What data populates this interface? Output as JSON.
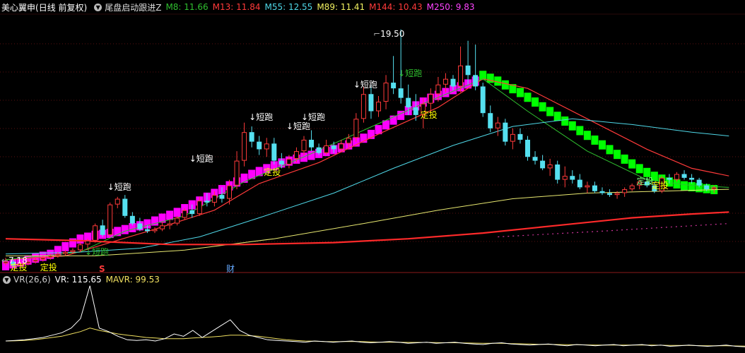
{
  "stock_title": "美心翼申",
  "period_label": "(日线 前复权)",
  "dropdown_icon": "chevron-down-icon",
  "indicator_name": "尾盘启动跟进Z",
  "ma_values": [
    {
      "label": "M8: 11.66",
      "color": "#2fbf2f"
    },
    {
      "label": "M13: 11.84",
      "color": "#ff3a3a"
    },
    {
      "label": "M55: 12.55",
      "color": "#4fd8e8"
    },
    {
      "label": "M89: 11.41",
      "color": "#f0f060"
    },
    {
      "label": "M144: 10.43",
      "color": "#ff3a3a"
    },
    {
      "label": "M250: 9.83",
      "color": "#ff44ff"
    }
  ],
  "high_label": "19.50",
  "low_label": "7.18",
  "markers": {
    "short_run": "↓短跑",
    "short_run_up": "↓短跑",
    "dca": "定投",
    "finance": "财",
    "s_mark": "S"
  },
  "vr_panel": {
    "name": "VR(26,6)",
    "vr": "VR: 115.65",
    "mavr": "MAVR: 99.53",
    "vr_color": "#ffffff",
    "mavr_color": "#f0e060"
  },
  "colors": {
    "up": "#ff3a3a",
    "down": "#55e0f0",
    "magenta": "#ff00ff",
    "green": "#00ff00",
    "label": "#ffffff",
    "dca": "#ffff00",
    "green_label": "#2fbf2f"
  },
  "chart_data": {
    "type": "candlestick",
    "price_range": [
      6.8,
      20.3
    ],
    "candles": [
      [
        7.2,
        7.5,
        7.1,
        7.3
      ],
      [
        7.3,
        7.4,
        7.0,
        7.1
      ],
      [
        7.1,
        7.3,
        7.0,
        7.2
      ],
      [
        7.2,
        7.4,
        7.1,
        7.3
      ],
      [
        7.3,
        7.5,
        7.2,
        7.4
      ],
      [
        7.4,
        7.6,
        7.3,
        7.5
      ],
      [
        7.5,
        7.7,
        7.4,
        7.6
      ],
      [
        7.6,
        7.8,
        7.5,
        7.7
      ],
      [
        7.7,
        7.9,
        7.6,
        7.8
      ],
      [
        7.8,
        8.0,
        7.7,
        7.9
      ],
      [
        7.9,
        8.3,
        7.8,
        8.2
      ],
      [
        8.2,
        8.5,
        8.0,
        8.4
      ],
      [
        8.4,
        9.3,
        8.3,
        9.2
      ],
      [
        9.2,
        9.5,
        8.6,
        8.7
      ],
      [
        8.7,
        10.4,
        8.6,
        10.3
      ],
      [
        10.3,
        10.7,
        10.1,
        10.6
      ],
      [
        10.6,
        10.8,
        9.6,
        9.7
      ],
      [
        9.7,
        9.9,
        9.2,
        9.3
      ],
      [
        9.3,
        9.6,
        8.9,
        9.0
      ],
      [
        9.0,
        9.2,
        8.8,
        8.9
      ],
      [
        8.9,
        9.1,
        8.8,
        9.0
      ],
      [
        9.0,
        9.4,
        8.9,
        9.2
      ],
      [
        9.2,
        9.5,
        9.0,
        9.3
      ],
      [
        9.3,
        9.7,
        9.2,
        9.6
      ],
      [
        9.6,
        10.1,
        9.5,
        10.0
      ],
      [
        10.0,
        10.3,
        9.6,
        9.8
      ],
      [
        9.8,
        10.7,
        9.7,
        10.5
      ],
      [
        10.5,
        10.9,
        10.2,
        10.4
      ],
      [
        10.4,
        11.0,
        10.2,
        10.8
      ],
      [
        10.8,
        11.2,
        10.4,
        10.6
      ],
      [
        10.6,
        11.6,
        10.3,
        11.3
      ],
      [
        11.3,
        13.1,
        11.1,
        12.6
      ],
      [
        12.6,
        14.6,
        12.3,
        14.1
      ],
      [
        14.1,
        14.4,
        13.3,
        13.6
      ],
      [
        13.6,
        13.9,
        12.9,
        13.2
      ],
      [
        13.2,
        13.8,
        12.8,
        13.5
      ],
      [
        13.5,
        13.8,
        12.4,
        12.6
      ],
      [
        12.6,
        13.0,
        12.2,
        12.4
      ],
      [
        12.4,
        12.9,
        12.2,
        12.7
      ],
      [
        12.7,
        13.3,
        12.5,
        13.1
      ],
      [
        13.1,
        13.9,
        12.9,
        13.7
      ],
      [
        13.7,
        14.2,
        13.1,
        13.3
      ],
      [
        13.3,
        13.5,
        12.9,
        13.0
      ],
      [
        13.0,
        13.7,
        12.9,
        13.4
      ],
      [
        13.4,
        13.6,
        13.0,
        13.2
      ],
      [
        13.2,
        13.7,
        13.1,
        13.5
      ],
      [
        13.5,
        14.0,
        13.3,
        13.8
      ],
      [
        13.8,
        15.1,
        13.6,
        14.8
      ],
      [
        14.8,
        16.5,
        14.6,
        16.1
      ],
      [
        16.1,
        16.6,
        14.8,
        15.2
      ],
      [
        15.2,
        16.0,
        14.9,
        15.7
      ],
      [
        15.7,
        17.1,
        15.3,
        16.7
      ],
      [
        16.7,
        18.1,
        16.1,
        16.4
      ],
      [
        16.4,
        19.5,
        15.6,
        15.9
      ],
      [
        15.9,
        16.6,
        15.0,
        15.4
      ],
      [
        15.4,
        16.1,
        14.7,
        15.0
      ],
      [
        15.0,
        15.9,
        14.3,
        15.6
      ],
      [
        15.6,
        16.4,
        15.1,
        16.1
      ],
      [
        16.1,
        17.0,
        15.7,
        16.6
      ],
      [
        16.6,
        17.2,
        16.2,
        16.9
      ],
      [
        16.9,
        17.1,
        16.3,
        16.5
      ],
      [
        16.5,
        18.6,
        16.2,
        17.6
      ],
      [
        17.6,
        18.9,
        16.6,
        17.1
      ],
      [
        17.1,
        18.7,
        16.3,
        16.5
      ],
      [
        16.5,
        16.7,
        14.9,
        15.1
      ],
      [
        15.1,
        15.5,
        14.1,
        14.3
      ],
      [
        14.3,
        14.9,
        13.9,
        14.6
      ],
      [
        14.6,
        14.8,
        13.4,
        13.6
      ],
      [
        13.6,
        14.3,
        13.2,
        14.0
      ],
      [
        14.0,
        14.3,
        13.5,
        13.7
      ],
      [
        13.7,
        13.9,
        12.6,
        12.8
      ],
      [
        12.8,
        13.1,
        12.4,
        12.6
      ],
      [
        12.6,
        12.9,
        12.1,
        12.2
      ],
      [
        12.2,
        12.7,
        11.8,
        12.4
      ],
      [
        12.4,
        12.6,
        11.4,
        11.6
      ],
      [
        11.6,
        12.3,
        11.2,
        11.8
      ],
      [
        11.8,
        12.1,
        11.4,
        11.6
      ],
      [
        11.6,
        11.9,
        11.1,
        11.2
      ],
      [
        11.2,
        11.5,
        10.9,
        11.3
      ],
      [
        11.3,
        11.5,
        10.9,
        11.0
      ],
      [
        11.0,
        11.2,
        10.8,
        10.9
      ],
      [
        10.9,
        11.1,
        10.7,
        10.8
      ],
      [
        10.8,
        11.0,
        10.6,
        10.9
      ],
      [
        10.9,
        11.2,
        10.7,
        11.1
      ],
      [
        11.1,
        11.4,
        11.0,
        11.3
      ],
      [
        11.3,
        11.6,
        11.1,
        11.5
      ],
      [
        11.5,
        11.7,
        11.2,
        11.3
      ],
      [
        11.3,
        11.5,
        10.9,
        11.0
      ],
      [
        11.0,
        11.8,
        10.9,
        11.7
      ],
      [
        11.7,
        11.9,
        11.4,
        11.6
      ],
      [
        11.6,
        12.0,
        11.5,
        11.9
      ],
      [
        11.9,
        12.1,
        11.6,
        11.7
      ],
      [
        11.7,
        11.9,
        11.4,
        11.6
      ],
      [
        11.6,
        11.7,
        11.2,
        11.3
      ],
      [
        11.3,
        11.4,
        11.0,
        11.1
      ],
      [
        11.1,
        11.3,
        10.9,
        11.2
      ]
    ],
    "band": {
      "magenta": [
        7.1,
        7.2,
        7.3,
        7.4,
        7.5,
        7.6,
        7.7,
        7.9,
        8.1,
        8.3,
        8.5,
        8.6,
        8.7,
        8.75,
        8.8,
        8.9,
        9.0,
        9.1,
        9.2,
        9.3,
        9.45,
        9.6,
        9.75,
        9.9,
        10.1,
        10.3,
        10.5,
        10.7,
        10.9,
        11.1,
        11.3,
        11.5,
        11.7,
        11.9,
        12.05,
        12.2,
        12.35,
        12.5,
        12.6,
        12.7,
        12.8,
        12.9,
        13.0,
        13.1,
        13.2,
        13.3,
        13.45,
        13.6,
        13.8,
        14.0,
        14.25,
        14.5,
        14.75,
        15.0,
        15.25,
        15.5,
        15.7,
        15.9,
        16.05,
        16.2,
        16.35,
        16.5,
        16.65,
        16.8
      ],
      "green_start": 64,
      "green": [
        17.1,
        16.95,
        16.8,
        16.6,
        16.4,
        16.2,
        15.95,
        15.7,
        15.45,
        15.2,
        14.95,
        14.7,
        14.45,
        14.2,
        13.95,
        13.7,
        13.45,
        13.2,
        12.95,
        12.7,
        12.45,
        12.2,
        12.0,
        11.8,
        11.65,
        11.5,
        11.4,
        11.3,
        11.25,
        11.2,
        11.15,
        11.1
      ]
    },
    "lines": [
      {
        "name": "M13",
        "color": "#ff3a3a",
        "width": 1.2,
        "points": [
          [
            0,
            7.4
          ],
          [
            8,
            7.6
          ],
          [
            14,
            8.3
          ],
          [
            20,
            9.0
          ],
          [
            28,
            10.0
          ],
          [
            34,
            11.4
          ],
          [
            42,
            12.5
          ],
          [
            50,
            14.0
          ],
          [
            58,
            15.4
          ],
          [
            64,
            16.9
          ],
          [
            70,
            16.4
          ],
          [
            78,
            14.8
          ],
          [
            86,
            13.2
          ],
          [
            92,
            12.2
          ],
          [
            97,
            11.8
          ]
        ]
      },
      {
        "name": "M8",
        "color": "#2fbf2f",
        "width": 1,
        "points": [
          [
            0,
            7.4
          ],
          [
            10,
            7.8
          ],
          [
            16,
            8.9
          ],
          [
            24,
            9.7
          ],
          [
            32,
            11.5
          ],
          [
            40,
            12.8
          ],
          [
            48,
            14.2
          ],
          [
            56,
            15.6
          ],
          [
            64,
            16.9
          ],
          [
            70,
            15.2
          ],
          [
            78,
            13.1
          ],
          [
            86,
            11.6
          ],
          [
            92,
            11.3
          ],
          [
            97,
            11.2
          ]
        ]
      },
      {
        "name": "M55",
        "color": "#4fd8e8",
        "width": 1,
        "points": [
          [
            0,
            7.7
          ],
          [
            10,
            7.8
          ],
          [
            18,
            8.0
          ],
          [
            26,
            8.6
          ],
          [
            34,
            9.6
          ],
          [
            44,
            10.9
          ],
          [
            52,
            12.2
          ],
          [
            60,
            13.4
          ],
          [
            68,
            14.4
          ],
          [
            76,
            14.8
          ],
          [
            84,
            14.5
          ],
          [
            92,
            14.1
          ],
          [
            97,
            13.9
          ]
        ]
      },
      {
        "name": "M89",
        "color": "#e8e870",
        "width": 1,
        "points": [
          [
            0,
            7.6
          ],
          [
            12,
            7.6
          ],
          [
            24,
            7.9
          ],
          [
            36,
            8.5
          ],
          [
            48,
            9.3
          ],
          [
            58,
            10.0
          ],
          [
            68,
            10.6
          ],
          [
            78,
            10.9
          ],
          [
            88,
            11.0
          ],
          [
            97,
            11.1
          ]
        ]
      },
      {
        "name": "M144",
        "color": "#ff2a2a",
        "width": 2.2,
        "points": [
          [
            0,
            8.5
          ],
          [
            10,
            8.4
          ],
          [
            22,
            8.2
          ],
          [
            32,
            8.2
          ],
          [
            44,
            8.3
          ],
          [
            54,
            8.5
          ],
          [
            64,
            8.8
          ],
          [
            74,
            9.2
          ],
          [
            84,
            9.6
          ],
          [
            92,
            9.8
          ],
          [
            97,
            9.9
          ]
        ]
      },
      {
        "name": "M250",
        "color": "#cc3399",
        "width": 1.2,
        "dashed": true,
        "points": [
          [
            66,
            8.6
          ],
          [
            80,
            8.9
          ],
          [
            97,
            9.3
          ]
        ]
      }
    ],
    "signals": {
      "short_run": [
        [
          14,
          11.2
        ],
        [
          25,
          12.7
        ],
        [
          33,
          14.9
        ],
        [
          38,
          14.4
        ],
        [
          40,
          14.9
        ],
        [
          47,
          16.6
        ]
      ],
      "short_run_green": [
        [
          53,
          17.2
        ],
        [
          11,
          7.8
        ]
      ],
      "dca": [
        [
          1,
          7.0
        ],
        [
          5,
          7.0
        ],
        [
          35,
          12.0
        ],
        [
          56,
          15.0
        ],
        [
          87,
          11.3
        ]
      ],
      "dca_green": [
        [
          85,
          11.5
        ]
      ]
    },
    "vr": {
      "range": [
        0,
        600
      ],
      "vr": [
        90,
        95,
        100,
        110,
        120,
        140,
        160,
        200,
        280,
        560,
        200,
        170,
        130,
        100,
        95,
        100,
        90,
        110,
        150,
        130,
        180,
        120,
        170,
        220,
        270,
        180,
        140,
        120,
        100,
        95,
        90,
        85,
        80,
        90,
        85,
        80,
        85,
        90,
        80,
        75,
        80,
        85,
        80,
        70,
        75,
        80,
        70,
        75,
        80,
        70,
        65,
        60,
        70,
        75,
        65,
        60,
        55,
        60,
        65,
        55,
        50,
        60,
        55,
        50,
        55,
        60,
        50,
        55,
        60,
        50,
        55,
        45,
        50,
        55,
        50,
        45,
        50,
        55,
        45,
        40
      ],
      "mavr": [
        90,
        92,
        95,
        100,
        110,
        120,
        130,
        150,
        170,
        200,
        180,
        165,
        150,
        140,
        130,
        120,
        115,
        110,
        110,
        110,
        115,
        120,
        125,
        130,
        140,
        140,
        135,
        130,
        120,
        110,
        100,
        95,
        90,
        88,
        85,
        84,
        85,
        86,
        85,
        82,
        80,
        80,
        80,
        78,
        78,
        78,
        76,
        75,
        75,
        74,
        72,
        70,
        70,
        70,
        68,
        66,
        64,
        62,
        62,
        60,
        58,
        58,
        57,
        56,
        55,
        56,
        55,
        55,
        56,
        55,
        54,
        52,
        52,
        52,
        51,
        50,
        50,
        50,
        48,
        46
      ]
    }
  }
}
